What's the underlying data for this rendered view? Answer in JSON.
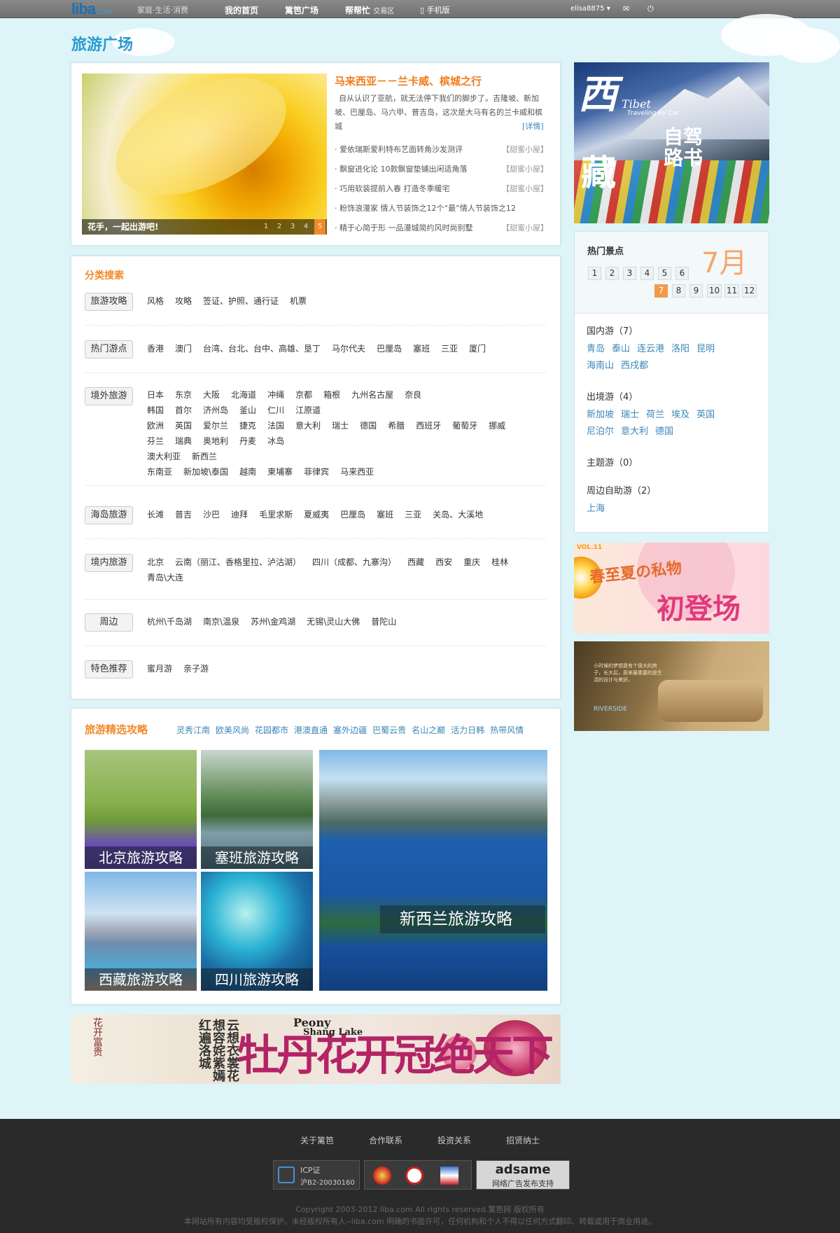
{
  "topbar": {
    "logo": "liba",
    "logo_suffix": ".com",
    "slogan": "家庭·生活·消费",
    "nav": [
      "我的首页",
      "篱笆广场",
      "帮帮忙"
    ],
    "nav_sub": "交易区",
    "mobile": "手机版",
    "user": "elisa8875",
    "user_arrow": "▾",
    "icons": [
      "mail-icon",
      "power-icon"
    ]
  },
  "page_title": "旅游广场",
  "featured": {
    "caption": "花手，一起出游吧!",
    "pages": [
      "1",
      "2",
      "3",
      "4",
      "5"
    ],
    "active_page": "5",
    "title": "马来西亚－－兰卡威、槟城之行",
    "desc": "自从认识了亚航，就无法停下我们的脚步了。吉隆坡、新加坡、巴厘岛、马六甲、普吉岛，这次是大马有名的兰卡威和槟城",
    "more": "[详情]",
    "items": [
      {
        "text": "· 爱依瑞斯爱利特布艺面转角沙发测评",
        "src": "【甜蜜小屋】"
      },
      {
        "text": "· 飘窗进化论  10款飘窗垫铺出闲适角落",
        "src": "【甜蜜小屋】"
      },
      {
        "text": "· 巧用软装提前入春  打造冬季暖宅",
        "src": "【甜蜜小屋】"
      },
      {
        "text": "· 粉饰浪漫家  情人节装饰之12个“最”情人节装饰之12",
        "src": ""
      },
      {
        "text": "· 精于心简于形  一品漫城简约风时尚别墅",
        "src": "【甜蜜小屋】"
      }
    ]
  },
  "tibet_ad": {
    "t1": "西",
    "t2": "Tibet",
    "t3": "Traveling By Car",
    "t4": "藏",
    "t5": "自驾路书"
  },
  "hot": {
    "title": "热门景点",
    "month_label": "7月",
    "months_row1": [
      "1",
      "2",
      "3",
      "4",
      "5",
      "6"
    ],
    "months_row2": [
      "7",
      "8",
      "9",
      "10",
      "11",
      "12"
    ],
    "active_month": "7",
    "groups": [
      {
        "title": "国内游（7）",
        "items": [
          "青岛",
          "泰山",
          "连云港",
          "洛阳",
          "昆明",
          "海南山",
          "西戌都"
        ]
      },
      {
        "title": "出境游（4）",
        "items": [
          "新加坡",
          "瑞士",
          "荷兰",
          "埃及",
          "英国",
          "尼泊尔",
          "意大利",
          "德国"
        ]
      },
      {
        "title": "主题游（0）",
        "items": []
      },
      {
        "title": "周边自助游（2）",
        "items": [
          "上海"
        ]
      }
    ]
  },
  "ad1": {
    "vol": "VOL.11",
    "line1": "春至夏の私物",
    "line2": "初登场"
  },
  "ad2": {
    "text": "小时候的梦想是有个很大的房子，长大后，原来最重要的是生活的设计与美好。",
    "logo": "RIVERSIDE"
  },
  "search": {
    "title": "分类搜索",
    "categories": [
      {
        "name": "旅游攻略",
        "rows": [
          {
            "label": "风格",
            "links": [
              "攻略",
              "签证、护照、通行证",
              "机票"
            ]
          }
        ]
      },
      {
        "name": "热门游点",
        "rows": [
          {
            "label": "",
            "links": [
              "香港",
              "澳门",
              "台湾、台北、台中、高雄、垦丁",
              "马尔代夫",
              "巴厘岛",
              "塞班",
              "三亚",
              "厦门"
            ]
          }
        ]
      },
      {
        "name": "境外旅游",
        "rows": [
          {
            "label": "日本",
            "links": [
              "东京",
              "大阪",
              "北海道",
              "冲绳",
              "京都",
              "箱根",
              "九州名古屋",
              "奈良"
            ]
          },
          {
            "label": "韩国",
            "links": [
              "首尔",
              "济州岛",
              "釜山",
              "仁川",
              "江原道"
            ]
          },
          {
            "label": "欧洲",
            "links": [
              "英国",
              "爱尔兰",
              "捷克",
              "法国",
              "意大利",
              "瑞士",
              "德国",
              "希腊",
              "西班牙",
              "葡萄牙",
              "挪威",
              "芬兰",
              "瑞典",
              "奥地利",
              "丹麦",
              "冰岛"
            ]
          },
          {
            "label": "澳大利亚",
            "links": []
          },
          {
            "label": "新西兰",
            "links": []
          },
          {
            "label": "东南亚",
            "links": [
              "新加坡\\泰国",
              "越南",
              "柬埔寨",
              "菲律宾",
              "马来西亚"
            ]
          }
        ]
      },
      {
        "name": "海岛旅游",
        "rows": [
          {
            "label": "",
            "links": [
              "长滩",
              "普吉",
              "沙巴",
              "迪拜",
              "毛里求斯",
              "夏威夷",
              "巴厘岛",
              "塞班",
              "三亚",
              "关岛、大溪地"
            ]
          }
        ]
      },
      {
        "name": "境内旅游",
        "rows": [
          {
            "label": "",
            "links": [
              "北京",
              "云南（丽江、香格里拉、泸沽湖）",
              "四川（成都、九寨沟）",
              "西藏",
              "西安",
              "重庆",
              "桂林",
              "青岛\\大连"
            ]
          }
        ]
      },
      {
        "name": "周边",
        "rows": [
          {
            "label": "",
            "links": [
              "杭州\\千岛湖",
              "南京\\温泉",
              "苏州\\金鸡湖",
              "无锡\\灵山大佛",
              "普陀山"
            ]
          }
        ]
      },
      {
        "name": "特色推荐",
        "rows": [
          {
            "label": "",
            "links": [
              "蜜月游",
              "亲子游"
            ]
          }
        ]
      }
    ]
  },
  "guides": {
    "title": "旅游精选攻略",
    "tabs": [
      "灵秀江南",
      "欧美风尚",
      "花园都市",
      "港澳直通",
      "塞外边疆",
      "巴蜀云贵",
      "名山之巅",
      "活力日韩",
      "热带风情"
    ],
    "items": [
      "北京旅游攻略",
      "塞班旅游攻略",
      "西藏旅游攻略",
      "四川旅游攻略",
      "新西兰旅游攻略"
    ]
  },
  "peony_ad": {
    "seal": "花开富贵",
    "poem": "云想衣裳花想容姹紫嫣红遍洛城",
    "en1": "Peony",
    "en2": "Shang Lake",
    "big": "牡丹花开冠绝天下"
  },
  "footer": {
    "links": [
      "关于篱笆",
      "合作联系",
      "投资关系",
      "招贤纳士"
    ],
    "icp_title": "ICP证",
    "icp_no": "沪B2-20030160",
    "adsame_logo": "adsame",
    "adsame_text": "网络广告发布支持",
    "copyright": "Copyright 2003-2012 liba.com All rights reserved.篱笆网 版权所有",
    "notice": "本网站所有内容均受版权保护。未经版权所有人--liba.com 明确的书面许可，任何机构和个人不得以任何方式翻印、转载或用于商业用途。"
  }
}
